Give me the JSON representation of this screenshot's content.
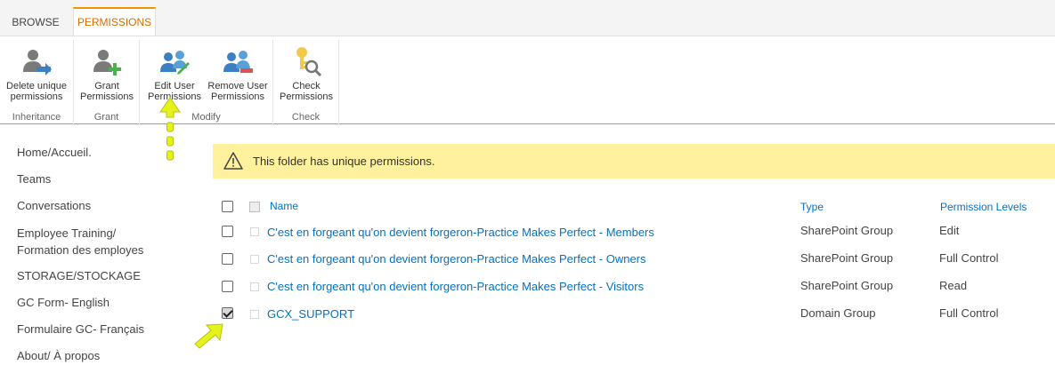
{
  "tabs": [
    {
      "label": "BROWSE"
    },
    {
      "label": "PERMISSIONS"
    }
  ],
  "ribbon": {
    "groups": [
      {
        "label": "Inheritance",
        "buttons": [
          {
            "line1": "Delete unique",
            "line2": "permissions",
            "icon": "delete-permissions-icon"
          }
        ]
      },
      {
        "label": "Grant",
        "buttons": [
          {
            "line1": "Grant",
            "line2": "Permissions",
            "icon": "grant-permissions-icon"
          }
        ]
      },
      {
        "label": "Modify",
        "buttons": [
          {
            "line1": "Edit User",
            "line2": "Permissions",
            "icon": "edit-user-permissions-icon"
          },
          {
            "line1": "Remove User",
            "line2": "Permissions",
            "icon": "remove-user-permissions-icon"
          }
        ]
      },
      {
        "label": "Check",
        "buttons": [
          {
            "line1": "Check",
            "line2": "Permissions",
            "icon": "check-permissions-icon"
          }
        ]
      }
    ]
  },
  "nav": {
    "items": [
      {
        "label": "Home/Accueil."
      },
      {
        "label": "Teams"
      },
      {
        "label": "Conversations"
      },
      {
        "label": "Employee Training/ Formation des employes"
      },
      {
        "label": "STORAGE/STOCKAGE"
      },
      {
        "label": "GC Form- English"
      },
      {
        "label": "Formulaire GC- Français"
      },
      {
        "label": "About/ À propos"
      }
    ]
  },
  "banner": {
    "text": "This folder has unique permissions.",
    "icon": "warning-icon"
  },
  "table": {
    "headers": {
      "name": "Name",
      "type": "Type",
      "permission_levels": "Permission Levels"
    },
    "rows": [
      {
        "name": "C'est en forgeant qu'on devient forgeron-Practice Makes Perfect - Members",
        "type": "SharePoint Group",
        "permission": "Edit",
        "checked": false
      },
      {
        "name": "C'est en forgeant qu'on devient forgeron-Practice Makes Perfect - Owners",
        "type": "SharePoint Group",
        "permission": "Full Control",
        "checked": false
      },
      {
        "name": "C'est en forgeant qu'on devient forgeron-Practice Makes Perfect - Visitors",
        "type": "SharePoint Group",
        "permission": "Read",
        "checked": false
      },
      {
        "name": "GCX_SUPPORT",
        "type": "Domain Group",
        "permission": "Full Control",
        "checked": true
      }
    ]
  },
  "colors": {
    "accent": "#f29200",
    "link": "#0072c6",
    "banner": "#fff19d",
    "annotation": "#e6f21c"
  }
}
